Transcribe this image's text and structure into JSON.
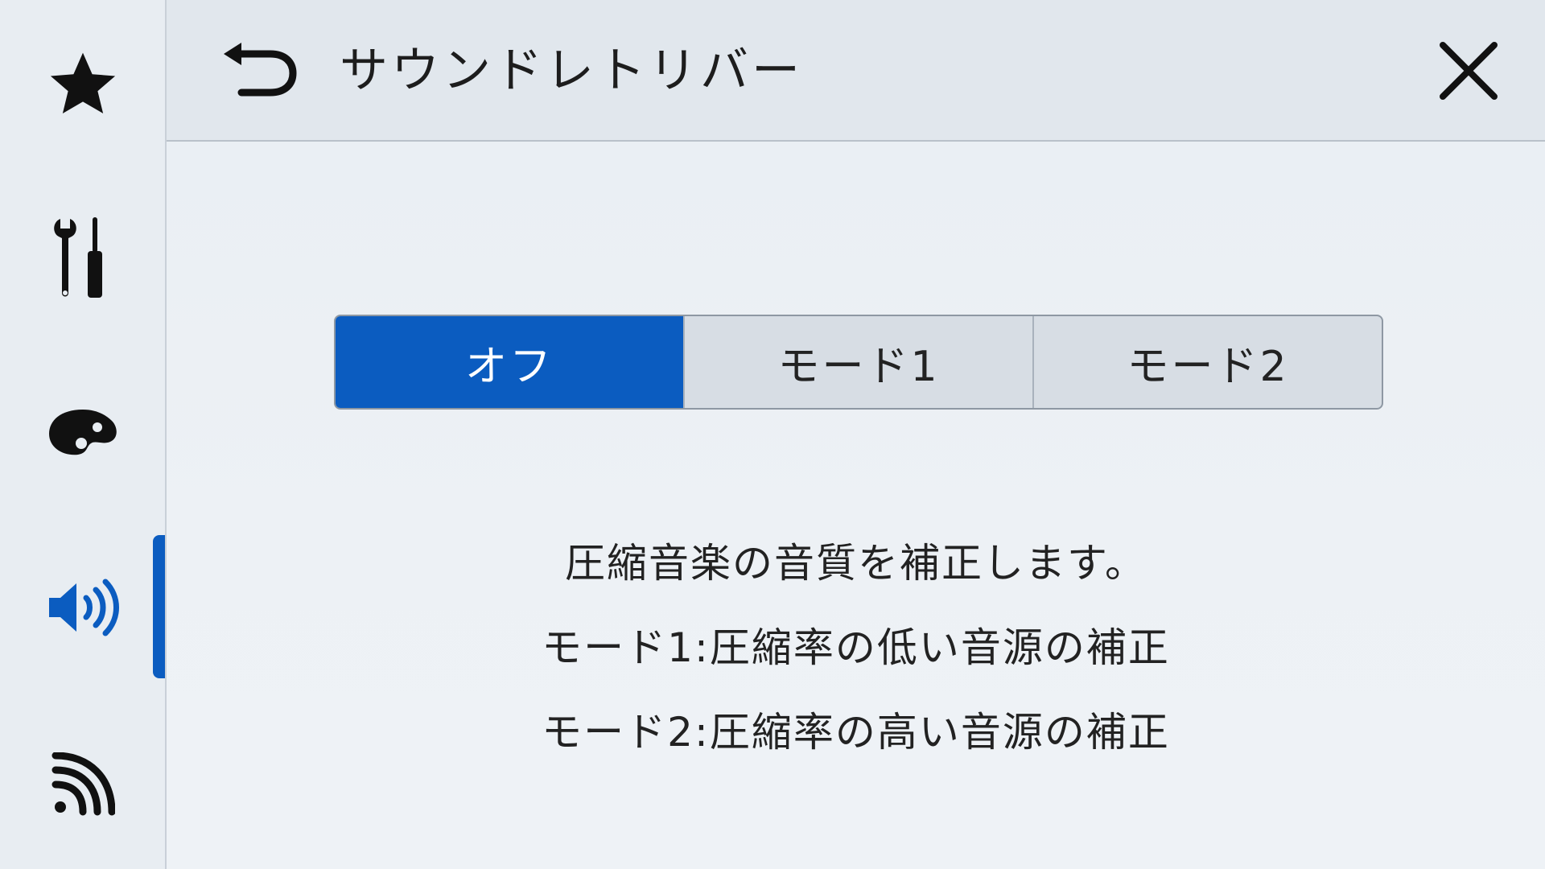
{
  "header": {
    "title": "サウンドレトリバー"
  },
  "sidebar": {
    "items": [
      {
        "icon": "star-icon"
      },
      {
        "icon": "settings-tools-icon"
      },
      {
        "icon": "palette-icon"
      },
      {
        "icon": "speaker-icon",
        "active": true
      },
      {
        "icon": "wireless-signal-icon"
      }
    ]
  },
  "options": {
    "selected": "オフ",
    "items": [
      "オフ",
      "モード1",
      "モード2"
    ]
  },
  "description": {
    "line1": "圧縮音楽の音質を補正します。",
    "line2": "モード1:圧縮率の低い音源の補正",
    "line3": "モード2:圧縮率の高い音源の補正"
  },
  "colors": {
    "accent": "#0b5cc0",
    "background": "#e9eef3"
  }
}
